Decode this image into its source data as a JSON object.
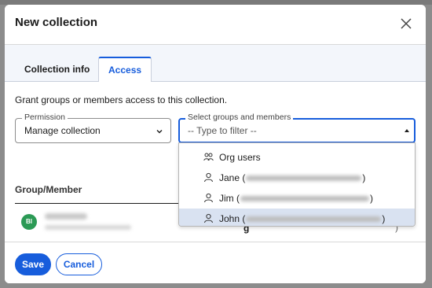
{
  "dialog": {
    "title": "New collection",
    "tabs": [
      {
        "label": "Collection info"
      },
      {
        "label": "Access"
      }
    ],
    "intro": "Grant groups or members access to this collection.",
    "permission": {
      "legend": "Permission",
      "value": "Manage collection"
    },
    "groups_members": {
      "legend": "Select groups and members",
      "placeholder": "-- Type to filter --"
    },
    "options": [
      {
        "label": "Org users",
        "icon": "group-icon"
      },
      {
        "label": "Jane (",
        "suffix": ")",
        "icon": "user-icon"
      },
      {
        "label": "Jim (",
        "suffix": ")",
        "icon": "user-icon"
      },
      {
        "label": "John (",
        "suffix": ")",
        "icon": "user-icon"
      }
    ],
    "table": {
      "column": "Group/Member",
      "row": {
        "avatar_initials": "BI",
        "cell_text": "g",
        "cell_end": ")"
      }
    },
    "footer": {
      "save_label": "Save",
      "cancel_label": "Cancel"
    }
  },
  "colors": {
    "accent": "#175ddc",
    "selected_option": "#d9e2f1",
    "avatar": "#2b9a55"
  }
}
